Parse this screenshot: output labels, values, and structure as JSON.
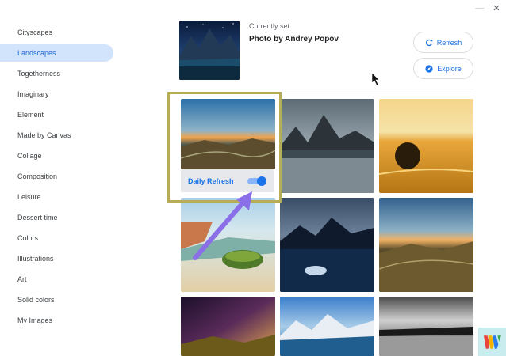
{
  "window": {
    "minimize_glyph": "—",
    "close_glyph": "✕"
  },
  "sidebar": {
    "items": [
      {
        "label": "Cityscapes"
      },
      {
        "label": "Landscapes",
        "selected": true
      },
      {
        "label": "Togetherness"
      },
      {
        "label": "Imaginary"
      },
      {
        "label": "Element"
      },
      {
        "label": "Made by Canvas"
      },
      {
        "label": "Collage"
      },
      {
        "label": "Composition"
      },
      {
        "label": "Leisure"
      },
      {
        "label": "Dessert time"
      },
      {
        "label": "Colors"
      },
      {
        "label": "Illustrations"
      },
      {
        "label": "Art"
      },
      {
        "label": "Solid colors"
      },
      {
        "label": "My Images"
      }
    ]
  },
  "current": {
    "label": "Currently set",
    "title": "Photo by Andrey Popov"
  },
  "actions": {
    "refresh_label": "Refresh",
    "refresh_icon": "refresh-icon",
    "explore_label": "Explore",
    "explore_icon": "compass-icon"
  },
  "daily_refresh": {
    "label": "Daily Refresh",
    "enabled": true
  },
  "colors": {
    "accent": "#1a73e8",
    "selected_bg": "#d2e3fc",
    "highlight_border": "#b8ad57",
    "annotation_arrow": "#8a6fe8"
  },
  "logo": {
    "icon": "w-logo-icon"
  }
}
